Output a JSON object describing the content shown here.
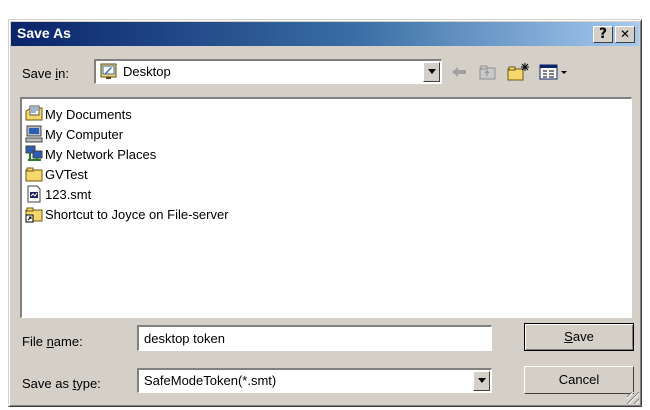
{
  "window": {
    "title": "Save As"
  },
  "titlebar_buttons": {
    "help": "?",
    "close": "✕"
  },
  "save_in": {
    "label_pre": "Save ",
    "label_hot": "i",
    "label_post": "n:",
    "value": "Desktop"
  },
  "files": [
    {
      "name": "My Documents",
      "icon": "my-documents-icon"
    },
    {
      "name": "My Computer",
      "icon": "my-computer-icon"
    },
    {
      "name": "My Network Places",
      "icon": "network-places-icon"
    },
    {
      "name": "GVTest",
      "icon": "folder-icon"
    },
    {
      "name": "123.smt",
      "icon": "smt-file-icon"
    },
    {
      "name": "Shortcut to Joyce on File-server",
      "icon": "shortcut-folder-icon"
    }
  ],
  "file_name": {
    "label_pre": "File ",
    "label_hot": "n",
    "label_post": "ame:",
    "value": "desktop token"
  },
  "save_as_type": {
    "label_pre": "Save as ",
    "label_hot": "t",
    "label_post": "ype:",
    "value": "SafeModeToken(*.smt)"
  },
  "buttons": {
    "save_hot": "S",
    "save_rest": "ave",
    "cancel": "Cancel"
  },
  "colors": {
    "face": "#d4d0c8",
    "title_start": "#0a246a",
    "title_end": "#a6caf0"
  }
}
